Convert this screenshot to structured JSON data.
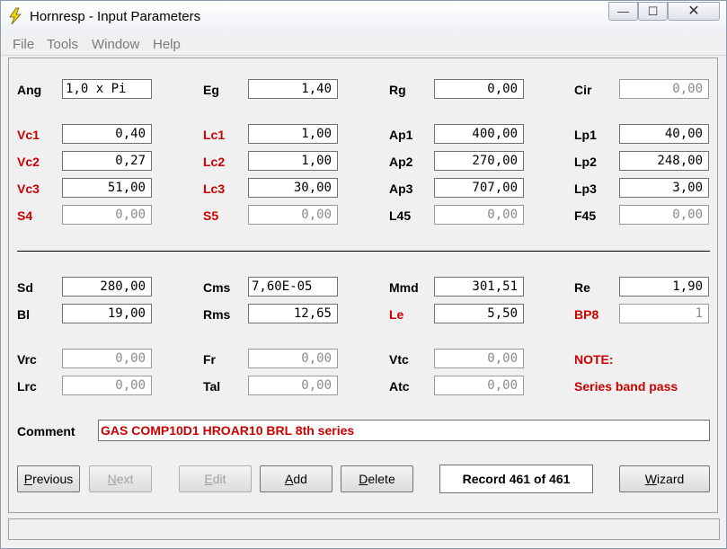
{
  "window": {
    "title": "Hornresp - Input Parameters",
    "close_glyph": "✕",
    "min_glyph": "—",
    "max_glyph": "☐"
  },
  "menu": [
    "File",
    "Tools",
    "Window",
    "Help"
  ],
  "row1": [
    {
      "label": "Ang",
      "value": "1,0 x Pi",
      "red": false,
      "disabled": false
    },
    {
      "label": "Eg",
      "value": "1,40",
      "red": false,
      "disabled": false
    },
    {
      "label": "Rg",
      "value": "0,00",
      "red": false,
      "disabled": false
    },
    {
      "label": "Cir",
      "value": "0,00",
      "red": false,
      "disabled": true
    }
  ],
  "vc": [
    {
      "label": "Vc1",
      "value": "0,40"
    },
    {
      "label": "Vc2",
      "value": "0,27"
    },
    {
      "label": "Vc3",
      "value": "51,00"
    },
    {
      "label": "S4",
      "value": "0,00"
    }
  ],
  "lc": [
    {
      "label": "Lc1",
      "value": "1,00"
    },
    {
      "label": "Lc2",
      "value": "1,00"
    },
    {
      "label": "Lc3",
      "value": "30,00"
    },
    {
      "label": "S5",
      "value": "0,00"
    }
  ],
  "ap": [
    {
      "label": "Ap1",
      "value": "400,00"
    },
    {
      "label": "Ap2",
      "value": "270,00"
    },
    {
      "label": "Ap3",
      "value": "707,00"
    },
    {
      "label": "L45",
      "value": "0,00"
    }
  ],
  "lp": [
    {
      "label": "Lp1",
      "value": "40,00"
    },
    {
      "label": "Lp2",
      "value": "248,00"
    },
    {
      "label": "Lp3",
      "value": "3,00"
    },
    {
      "label": "F45",
      "value": "0,00"
    }
  ],
  "driver": {
    "sd": {
      "label": "Sd",
      "value": "280,00"
    },
    "bl": {
      "label": "Bl",
      "value": "19,00"
    },
    "cms": {
      "label": "Cms",
      "value": "7,60E-05"
    },
    "rms": {
      "label": "Rms",
      "value": "12,65"
    },
    "mmd": {
      "label": "Mmd",
      "value": "301,51"
    },
    "le": {
      "label": "Le",
      "value": "5,50"
    },
    "re": {
      "label": "Re",
      "value": "1,90"
    },
    "bp8": {
      "label": "BP8",
      "value": "1"
    }
  },
  "chambers": {
    "vrc": {
      "label": "Vrc",
      "value": "0,00"
    },
    "lrc": {
      "label": "Lrc",
      "value": "0,00"
    },
    "fr": {
      "label": "Fr",
      "value": "0,00"
    },
    "tal": {
      "label": "Tal",
      "value": "0,00"
    },
    "vtc": {
      "label": "Vtc",
      "value": "0,00"
    },
    "atc": {
      "label": "Atc",
      "value": "0,00"
    }
  },
  "note": {
    "heading": "NOTE:",
    "text": "Series band pass"
  },
  "comment": {
    "label": "Comment",
    "value": "GAS COMP10D1 HROAR10 BRL 8th series"
  },
  "buttons": {
    "previous": {
      "first": "P",
      "rest": "revious"
    },
    "next": {
      "first": "N",
      "rest": "ext"
    },
    "edit": {
      "first": "E",
      "rest": "dit"
    },
    "add": {
      "first": "A",
      "rest": "dd"
    },
    "delete": {
      "first": "D",
      "rest": "elete"
    },
    "wizard": {
      "first": "W",
      "rest": "izard"
    }
  },
  "record": "Record 461 of 461",
  "colors": {
    "accent_red": "#cc0000",
    "disabled_text": "#8a8a8a"
  }
}
